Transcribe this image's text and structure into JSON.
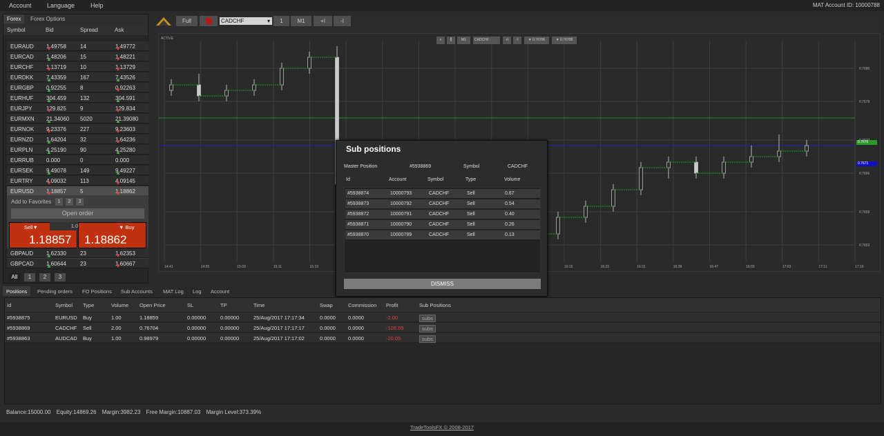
{
  "menu": {
    "items": [
      "Account",
      "Language",
      "Help"
    ],
    "account_id": "MAT Account ID: 10000788"
  },
  "left_tabs": [
    "Forex",
    "Forex Options"
  ],
  "quotes_header": {
    "symbol": "Symbol",
    "bid": "Bid",
    "spread": "Spread",
    "ask": "Ask"
  },
  "quotes": [
    {
      "symbol": "EURAUD",
      "bid": "1.49758",
      "bid_dir": "down",
      "spread": "14",
      "ask": "1.49772",
      "ask_dir": "down"
    },
    {
      "symbol": "EURCAD",
      "bid": "1.48206",
      "bid_dir": "up",
      "spread": "15",
      "ask": "1.48221",
      "ask_dir": "down"
    },
    {
      "symbol": "EURCHF",
      "bid": "1.13719",
      "bid_dir": "down",
      "spread": "10",
      "ask": "1.13729",
      "ask_dir": "down"
    },
    {
      "symbol": "EURDKK",
      "bid": "7.43359",
      "bid_dir": "up",
      "spread": "167",
      "ask": "7.43526",
      "ask_dir": "up"
    },
    {
      "symbol": "EURGBP",
      "bid": "0.92255",
      "bid_dir": "up",
      "spread": "8",
      "ask": "0.92263",
      "ask_dir": "down"
    },
    {
      "symbol": "EURHUF",
      "bid": "304.459",
      "bid_dir": "up",
      "spread": "132",
      "ask": "304.591",
      "ask_dir": "up"
    },
    {
      "symbol": "EURJPY",
      "bid": "129.825",
      "bid_dir": "down",
      "spread": "9",
      "ask": "129.834",
      "ask_dir": "down"
    },
    {
      "symbol": "EURMXN",
      "bid": "21.34060",
      "bid_dir": "up",
      "spread": "5020",
      "ask": "21.39080",
      "ask_dir": "up"
    },
    {
      "symbol": "EURNOK",
      "bid": "9.23376",
      "bid_dir": "down",
      "spread": "227",
      "ask": "9.23603",
      "ask_dir": "down"
    },
    {
      "symbol": "EURNZD",
      "bid": "1.64204",
      "bid_dir": "up",
      "spread": "32",
      "ask": "1.64236",
      "ask_dir": "down"
    },
    {
      "symbol": "EURPLN",
      "bid": "4.25190",
      "bid_dir": "up",
      "spread": "90",
      "ask": "4.25280",
      "ask_dir": "up"
    },
    {
      "symbol": "EURRUB",
      "bid": "0.000",
      "bid_dir": "none",
      "spread": "0",
      "ask": "0.000",
      "ask_dir": "none"
    },
    {
      "symbol": "EURSEK",
      "bid": "9.49078",
      "bid_dir": "up",
      "spread": "149",
      "ask": "9.49227",
      "ask_dir": "up"
    },
    {
      "symbol": "EURTRY",
      "bid": "4.09032",
      "bid_dir": "down",
      "spread": "113",
      "ask": "4.09145",
      "ask_dir": "down"
    },
    {
      "symbol": "EURUSD",
      "bid": "1.18857",
      "bid_dir": "down",
      "spread": "5",
      "ask": "1.18862",
      "ask_dir": "down"
    }
  ],
  "order": {
    "add_favorites": "Add to Favorites",
    "fav_buttons": [
      "1",
      "2",
      "3"
    ],
    "open_order": "Open order",
    "sell_label": "Sell",
    "buy_label": "Buy",
    "quantity": "1.00",
    "sell_price": "1.18857",
    "buy_price": "1.18862"
  },
  "quotes_after": [
    {
      "symbol": "GBPAUD",
      "bid": "1.62330",
      "bid_dir": "up",
      "spread": "23",
      "ask": "1.62353",
      "ask_dir": "down"
    },
    {
      "symbol": "GBPCAD",
      "bid": "1.60644",
      "bid_dir": "up",
      "spread": "23",
      "ask": "1.60667",
      "ask_dir": "down"
    }
  ],
  "left_pager": [
    "All",
    "1",
    "2",
    "3"
  ],
  "toolbar": {
    "full": "Full",
    "symbol": "CADCHF",
    "b1": "1",
    "b2": "M1",
    "b3": "+I",
    "b4": "-I"
  },
  "chart": {
    "active_label": "ACTIVE",
    "mini_symbol": "CADCHF",
    "mini_tf": "M1",
    "mini_plus": "+I",
    "mini_minus": "-I",
    "mini_bid": "0.76706",
    "mini_ask": "0.76708",
    "green_label": "0.7676",
    "blue_label": "0.7671"
  },
  "chart_data": {
    "type": "candlestick",
    "x_labels": [
      "14:41",
      "14:55",
      "15:03",
      "15:11",
      "15:19",
      "15:27",
      "15:35",
      "15:43",
      "15:51",
      "15:59",
      "16:07",
      "16:15",
      "16:23",
      "16:31",
      "16:39",
      "16:47",
      "16:55",
      "17:03",
      "17:11",
      "17:19"
    ],
    "y_labels": [
      "0.7680",
      "0.7679",
      "0.7672",
      "0.7666",
      "0.7659",
      "0.7653"
    ],
    "y_values": [
      0.7685,
      0.7679,
      0.7672,
      0.7666,
      0.7659,
      0.7653
    ],
    "ylim": [
      0.765,
      0.769
    ],
    "green_line": 0.7676,
    "blue_line": 0.7671,
    "candles": [
      {
        "o": 0.7681,
        "c": 0.7682,
        "h": 0.7683,
        "l": 0.768
      },
      {
        "o": 0.7682,
        "c": 0.768,
        "h": 0.7684,
        "l": 0.7679
      },
      {
        "o": 0.768,
        "c": 0.7681,
        "h": 0.7682,
        "l": 0.7679
      },
      {
        "o": 0.7681,
        "c": 0.7682,
        "h": 0.7683,
        "l": 0.768
      },
      {
        "o": 0.7682,
        "c": 0.7685,
        "h": 0.7686,
        "l": 0.7681
      },
      {
        "o": 0.7685,
        "c": 0.7687,
        "h": 0.7688,
        "l": 0.7684
      },
      {
        "o": 0.7687,
        "c": 0.7664,
        "h": 0.7689,
        "l": 0.7663
      },
      {
        "o": 0.7664,
        "c": 0.7662,
        "h": 0.7665,
        "l": 0.7661
      },
      {
        "o": 0.7662,
        "c": 0.7659,
        "h": 0.7663,
        "l": 0.7658
      },
      {
        "o": 0.7659,
        "c": 0.766,
        "h": 0.7661,
        "l": 0.7657
      },
      {
        "o": 0.766,
        "c": 0.7658,
        "h": 0.7661,
        "l": 0.7656
      },
      {
        "o": 0.7658,
        "c": 0.7657,
        "h": 0.7659,
        "l": 0.7655
      },
      {
        "o": 0.7657,
        "c": 0.7656,
        "h": 0.7658,
        "l": 0.7654
      },
      {
        "o": 0.7656,
        "c": 0.7655,
        "h": 0.7657,
        "l": 0.7653
      },
      {
        "o": 0.7655,
        "c": 0.7658,
        "h": 0.7659,
        "l": 0.7654
      },
      {
        "o": 0.7658,
        "c": 0.766,
        "h": 0.7661,
        "l": 0.7657
      },
      {
        "o": 0.766,
        "c": 0.7663,
        "h": 0.7664,
        "l": 0.7659
      },
      {
        "o": 0.7663,
        "c": 0.7667,
        "h": 0.7668,
        "l": 0.7662
      },
      {
        "o": 0.7667,
        "c": 0.7668,
        "h": 0.7669,
        "l": 0.7665
      },
      {
        "o": 0.7668,
        "c": 0.7666,
        "h": 0.7669,
        "l": 0.7665
      },
      {
        "o": 0.7666,
        "c": 0.7668,
        "h": 0.7669,
        "l": 0.7665
      },
      {
        "o": 0.7668,
        "c": 0.7669,
        "h": 0.7671,
        "l": 0.7667
      },
      {
        "o": 0.7669,
        "c": 0.767,
        "h": 0.7673,
        "l": 0.7668
      },
      {
        "o": 0.767,
        "c": 0.7671,
        "h": 0.7672,
        "l": 0.7669
      }
    ]
  },
  "modal": {
    "title": "Sub positions",
    "master_label": "Master Position",
    "master_value": "#5938869",
    "symbol_label": "Symbol",
    "symbol_value": "CADCHF",
    "headers": [
      "Id",
      "Account",
      "Symbol",
      "Type",
      "Volume"
    ],
    "rows": [
      [
        "#5938874",
        "10000793",
        "CADCHF",
        "Sell",
        "0.67"
      ],
      [
        "#5938873",
        "10000792",
        "CADCHF",
        "Sell",
        "0.54"
      ],
      [
        "#5938872",
        "10000791",
        "CADCHF",
        "Sell",
        "0.40"
      ],
      [
        "#5938871",
        "10000790",
        "CADCHF",
        "Sell",
        "0.26"
      ],
      [
        "#5938870",
        "10000789",
        "CADCHF",
        "Sell",
        "0.13"
      ]
    ],
    "dismiss": "DISMISS"
  },
  "bottom_tabs": [
    "Positions",
    "Pending orders",
    "FO Positions",
    "Sub Accounts",
    "MAT Log",
    "Log",
    "Account"
  ],
  "positions": {
    "headers": [
      "Id",
      "Symbol",
      "Type",
      "Volume",
      "Open Price",
      "SL",
      "TP",
      "Time",
      "Swap",
      "Commission",
      "Profit",
      "Sub Positions"
    ],
    "rows": [
      [
        "#5938875",
        "EURUSD",
        "Buy",
        "1.00",
        "1.18859",
        "0.00000",
        "0.00000",
        "25/Aug/2017 17:17:34",
        "0.0000",
        "0.0000",
        "-2.00",
        "subs"
      ],
      [
        "#5938869",
        "CADCHF",
        "Sell",
        "2.00",
        "0.76704",
        "0.00000",
        "0.00000",
        "25/Aug/2017 17:17:17",
        "0.0000",
        "0.0000",
        "-108.69",
        "subs"
      ],
      [
        "#5938863",
        "AUDCAD",
        "Buy",
        "1.00",
        "0.98979",
        "0.00000",
        "0.00000",
        "25/Aug/2017 17:17:02",
        "0.0000",
        "0.0000",
        "-20.05",
        "subs"
      ]
    ]
  },
  "status": {
    "balance": "Balance:15000.00",
    "equity": "Equity:14869.26",
    "margin": "Margin:3982.23",
    "free_margin": "Free Margin:10887.03",
    "margin_level": "Margin Level:373.39%"
  },
  "footer": "TradeToolsFX © 2008-2017",
  "colors": {
    "up": "#4bb24b",
    "down": "#e04040",
    "order": "#c0320f",
    "loss": "#e04040"
  }
}
